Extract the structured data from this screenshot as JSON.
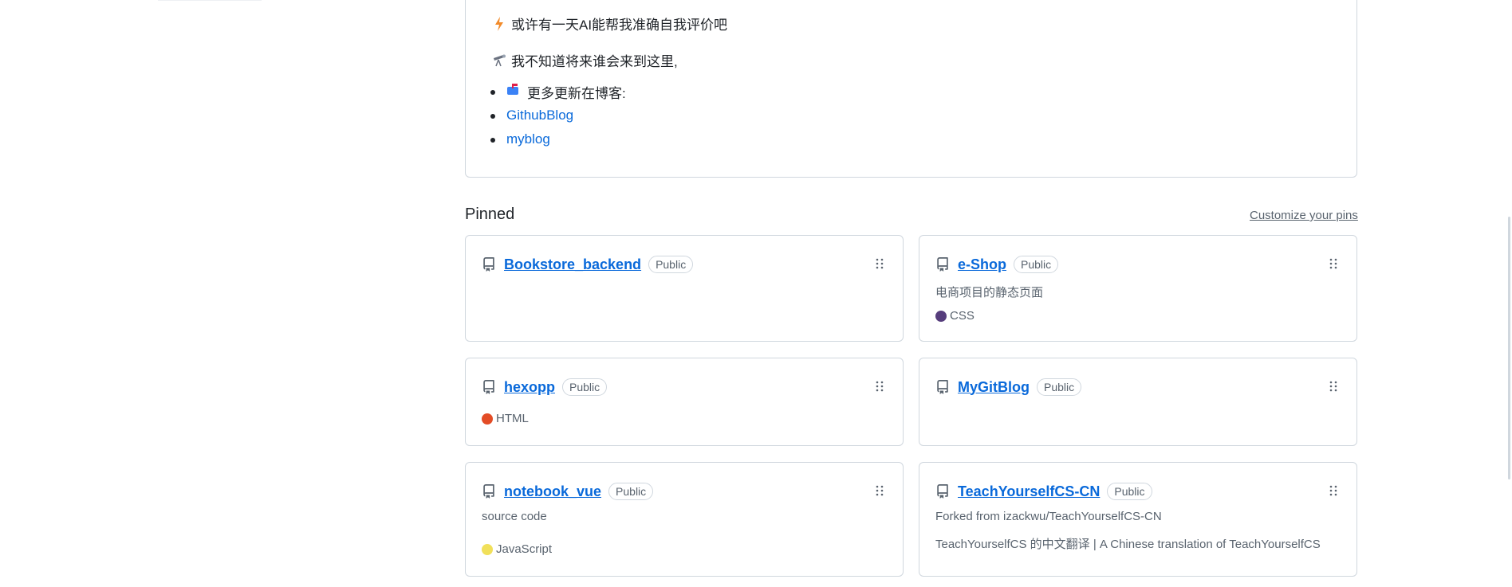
{
  "readme": {
    "line1": "或许有一天AI能帮我准确自我评价吧",
    "line2": "我不知道将来谁会来到这里,",
    "bullets": [
      "更多更新在博客:",
      "GithubBlog",
      "myblog"
    ]
  },
  "pinned": {
    "title": "Pinned",
    "customize": "Customize your pins",
    "repos": [
      {
        "name": "Bookstore_backend",
        "badge": "Public"
      },
      {
        "name": "e-Shop",
        "badge": "Public",
        "description": "电商项目的静态页面",
        "language": "CSS",
        "language_color": "#563d7c"
      },
      {
        "name": "hexopp",
        "badge": "Public",
        "language": "HTML",
        "language_color": "#e34c26"
      },
      {
        "name": "MyGitBlog",
        "badge": "Public"
      },
      {
        "name": "notebook_vue",
        "badge": "Public",
        "description": "source code",
        "language": "JavaScript",
        "language_color": "#f1e05a"
      },
      {
        "name": "TeachYourselfCS-CN",
        "badge": "Public",
        "forked_from": "Forked from izackwu/TeachYourselfCS-CN",
        "description": "TeachYourselfCS 的中文翻译 | A Chinese translation of TeachYourselfCS"
      }
    ]
  },
  "icons": {
    "lightning": "lightning-emoji-icon",
    "telescope": "telescope-emoji-icon",
    "mailbox": "mailbox-emoji-icon",
    "repo": "repo-icon",
    "grabber": "grabber-icon"
  }
}
